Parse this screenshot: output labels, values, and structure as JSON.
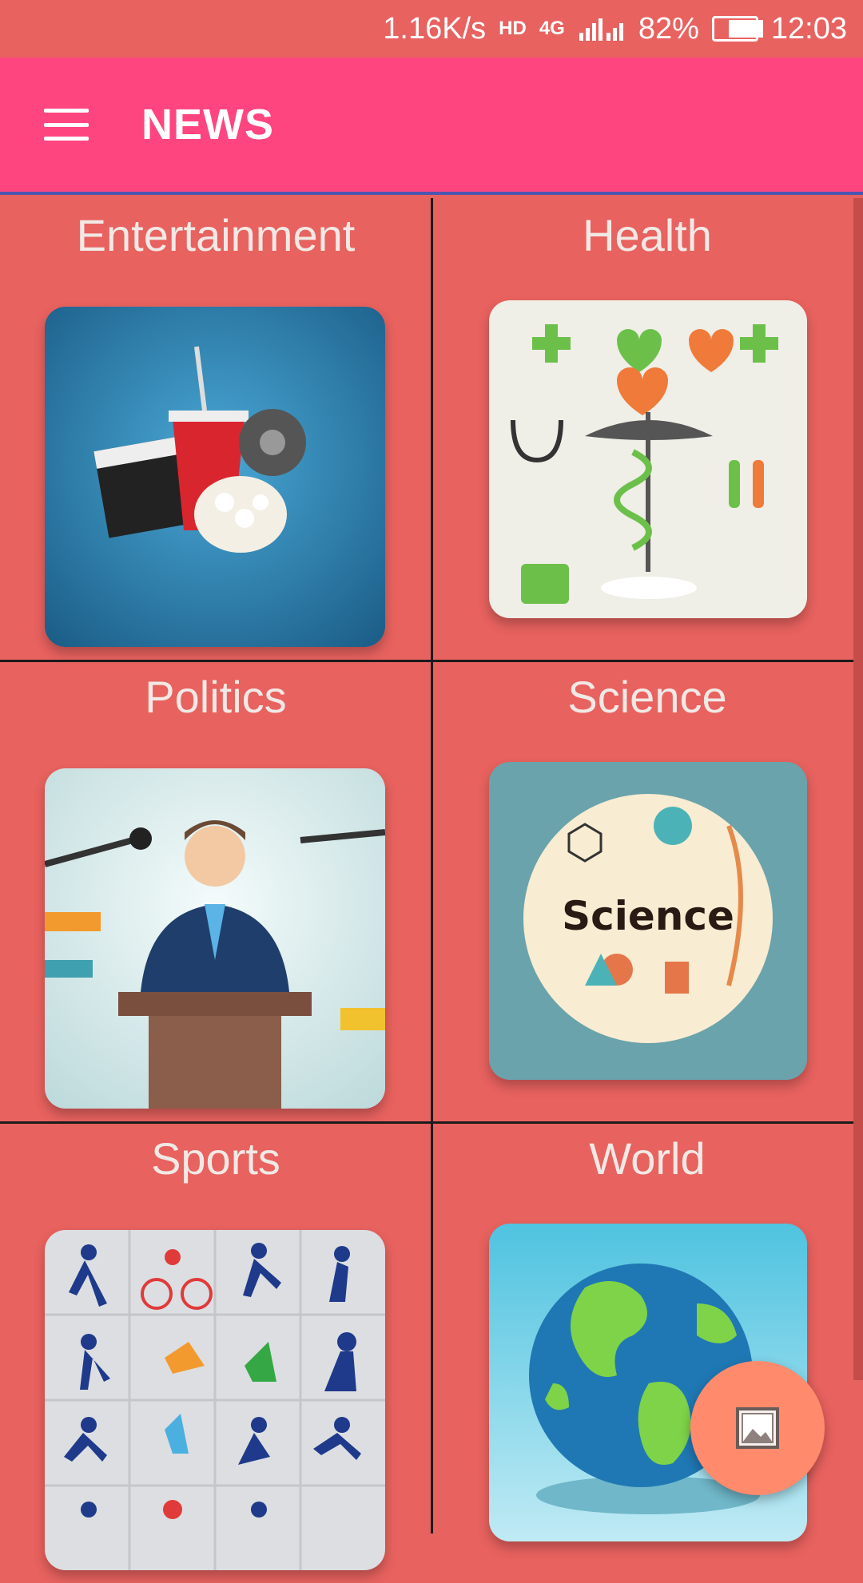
{
  "status_bar": {
    "speed": "1.16K/s",
    "network": "4G",
    "battery": "82%",
    "battery_level": 0.82,
    "time": "12:03"
  },
  "app_bar": {
    "title": "NEWS",
    "menu_icon": "hamburger-menu-icon"
  },
  "categories": [
    {
      "label": "Entertainment",
      "image": "entertainment-illustration"
    },
    {
      "label": "Health",
      "image": "health-illustration"
    },
    {
      "label": "Politics",
      "image": "politics-illustration"
    },
    {
      "label": "Science",
      "image": "science-illustration"
    },
    {
      "label": "Sports",
      "image": "sports-illustration"
    },
    {
      "label": "World",
      "image": "globe-illustration"
    }
  ],
  "image_labels": {
    "science": "Science"
  },
  "fab": {
    "icon": "image-icon"
  },
  "colors": {
    "background": "#e8625f",
    "app_bar": "#ff4580",
    "fab": "#ff8a6c"
  }
}
